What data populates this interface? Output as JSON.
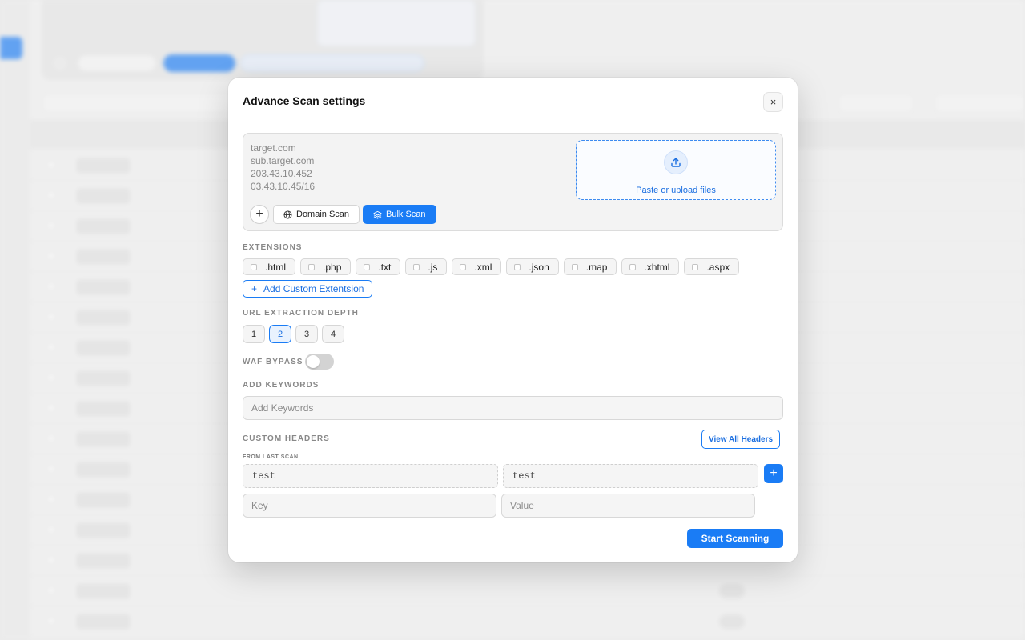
{
  "modal": {
    "title": "Advance Scan settings",
    "close_label": "×",
    "targets": [
      "target.com",
      "sub.target.com",
      "203.43.10.452",
      "03.43.10.45/16"
    ],
    "upload_label": "Paste or upload files",
    "add_label": "+",
    "domain_scan_label": "Domain Scan",
    "bulk_scan_label": "Bulk Scan",
    "extensions_label": "EXTENSIONS",
    "extensions": [
      ".html",
      ".php",
      ".txt",
      ".js",
      ".xml",
      ".json",
      ".map",
      ".xhtml",
      ".aspx"
    ],
    "add_custom_extension_label": "Add Custom Extentsion",
    "depth_label": "URL EXTRACTION DEPTH",
    "depth_options": [
      "1",
      "2",
      "3",
      "4"
    ],
    "depth_selected": "2",
    "waf_label": "WAF BYPASS",
    "waf_enabled": false,
    "keywords_label": "ADD KEYWORDS",
    "keywords_placeholder": "Add Keywords",
    "custom_headers_label": "CUSTOM HEADERS",
    "view_all_headers_label": "View All Headers",
    "from_last_scan_label": "FROM LAST SCAN",
    "last_scan_key": "test",
    "last_scan_value": "test",
    "add_header_label": "+",
    "key_placeholder": "Key",
    "value_placeholder": "Value",
    "start_label": "Start Scanning"
  },
  "colors": {
    "accent": "#1a7cf5",
    "accent_text": "#1a6ee0"
  },
  "icons": {
    "upload": "upload-icon",
    "globe": "globe-icon",
    "layers": "layers-icon",
    "close": "close-icon",
    "plus": "plus-icon"
  }
}
